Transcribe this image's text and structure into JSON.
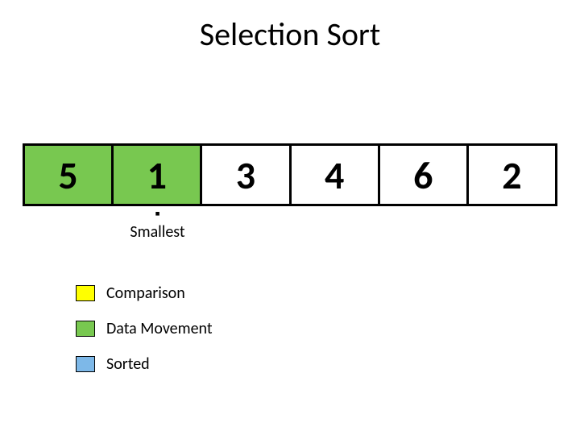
{
  "title": "Selection Sort",
  "colors": {
    "comparison": "#ffff00",
    "data_movement": "#78c850",
    "sorted": "#7db8e8"
  },
  "array": {
    "cells": [
      {
        "value": "5",
        "state": "data_movement"
      },
      {
        "value": "1",
        "state": "data_movement"
      },
      {
        "value": "3",
        "state": "none"
      },
      {
        "value": "4",
        "state": "none"
      },
      {
        "value": "6",
        "state": "none"
      },
      {
        "value": "2",
        "state": "none"
      }
    ]
  },
  "pointer": {
    "label": "Smallest",
    "cell_index": 1
  },
  "legend": {
    "items": [
      {
        "color_key": "comparison",
        "label": "Comparison"
      },
      {
        "color_key": "data_movement",
        "label": "Data Movement"
      },
      {
        "color_key": "sorted",
        "label": "Sorted"
      }
    ]
  }
}
